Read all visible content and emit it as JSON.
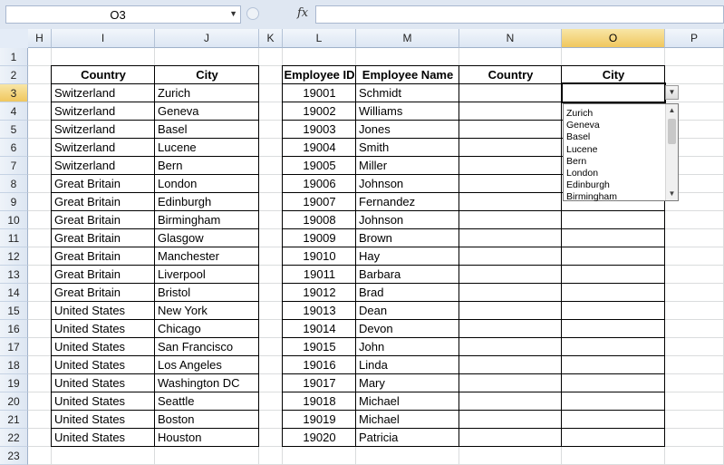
{
  "formula_bar": {
    "name_box": "O3",
    "fx_label": "fx",
    "formula": ""
  },
  "columns": [
    {
      "id": "H",
      "label": "H"
    },
    {
      "id": "I",
      "label": "I"
    },
    {
      "id": "J",
      "label": "J"
    },
    {
      "id": "K",
      "label": "K"
    },
    {
      "id": "L",
      "label": "L"
    },
    {
      "id": "M",
      "label": "M"
    },
    {
      "id": "N",
      "label": "N"
    },
    {
      "id": "O",
      "label": "O"
    },
    {
      "id": "P",
      "label": "P"
    }
  ],
  "rows": [
    "1",
    "2",
    "3",
    "4",
    "5",
    "6",
    "7",
    "8",
    "9",
    "10",
    "11",
    "12",
    "13",
    "14",
    "15",
    "16",
    "17",
    "18",
    "19",
    "20",
    "21",
    "22",
    "23"
  ],
  "selected": {
    "column": "O",
    "row": "3"
  },
  "table1": {
    "headers": {
      "country": "Country",
      "city": "City"
    },
    "rows": [
      {
        "country": "Switzerland",
        "city": "Zurich"
      },
      {
        "country": "Switzerland",
        "city": "Geneva"
      },
      {
        "country": "Switzerland",
        "city": "Basel"
      },
      {
        "country": "Switzerland",
        "city": "Lucene"
      },
      {
        "country": "Switzerland",
        "city": "Bern"
      },
      {
        "country": "Great Britain",
        "city": "London"
      },
      {
        "country": "Great Britain",
        "city": "Edinburgh"
      },
      {
        "country": "Great Britain",
        "city": "Birmingham"
      },
      {
        "country": "Great Britain",
        "city": "Glasgow"
      },
      {
        "country": "Great Britain",
        "city": "Manchester"
      },
      {
        "country": "Great Britain",
        "city": "Liverpool"
      },
      {
        "country": "Great Britain",
        "city": "Bristol"
      },
      {
        "country": "United States",
        "city": "New York"
      },
      {
        "country": "United States",
        "city": "Chicago"
      },
      {
        "country": "United States",
        "city": "San Francisco"
      },
      {
        "country": "United States",
        "city": "Los Angeles"
      },
      {
        "country": "United States",
        "city": "Washington DC"
      },
      {
        "country": "United States",
        "city": "Seattle"
      },
      {
        "country": "United States",
        "city": "Boston"
      },
      {
        "country": "United States",
        "city": "Houston"
      }
    ]
  },
  "table2": {
    "headers": {
      "employee_id": "Employee ID",
      "employee_name": "Employee Name",
      "country": "Country",
      "city": "City"
    },
    "rows": [
      {
        "id": "19001",
        "name": "Schmidt"
      },
      {
        "id": "19002",
        "name": "Williams"
      },
      {
        "id": "19003",
        "name": "Jones"
      },
      {
        "id": "19004",
        "name": "Smith"
      },
      {
        "id": "19005",
        "name": "Miller"
      },
      {
        "id": "19006",
        "name": "Johnson"
      },
      {
        "id": "19007",
        "name": "Fernandez"
      },
      {
        "id": "19008",
        "name": "Johnson"
      },
      {
        "id": "19009",
        "name": "Brown"
      },
      {
        "id": "19010",
        "name": "Hay"
      },
      {
        "id": "19011",
        "name": "Barbara"
      },
      {
        "id": "19012",
        "name": "Brad"
      },
      {
        "id": "19013",
        "name": "Dean"
      },
      {
        "id": "19014",
        "name": "Devon"
      },
      {
        "id": "19015",
        "name": "John"
      },
      {
        "id": "19016",
        "name": "Linda"
      },
      {
        "id": "19017",
        "name": "Mary"
      },
      {
        "id": "19018",
        "name": "Michael"
      },
      {
        "id": "19019",
        "name": "Michael"
      },
      {
        "id": "19020",
        "name": "Patricia"
      }
    ]
  },
  "dropdown": {
    "options": [
      "Zurich",
      "Geneva",
      "Basel",
      "Lucene",
      "Bern",
      "London",
      "Edinburgh",
      "Birmingham"
    ]
  }
}
